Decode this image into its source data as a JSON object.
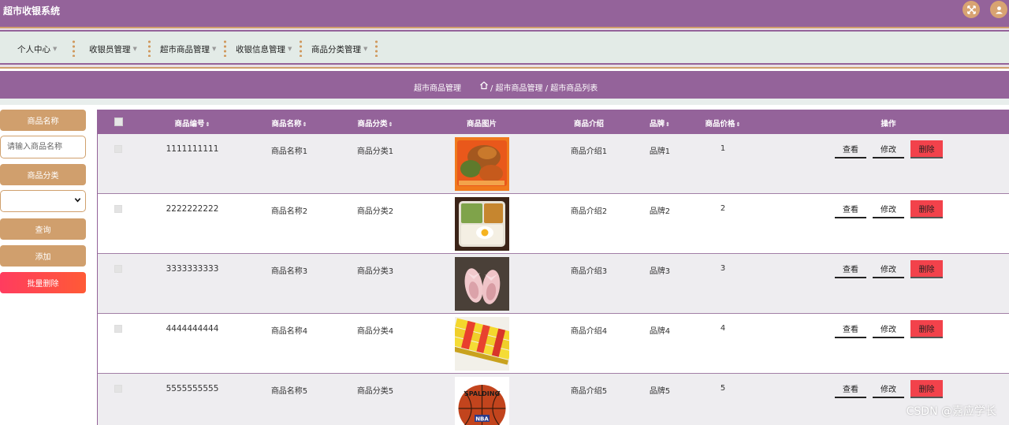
{
  "app": {
    "title": "超市收银系统"
  },
  "header": {
    "fullscreen_icon": "expand-icon",
    "user_icon": "user-icon"
  },
  "nav": {
    "items": [
      {
        "label": "个人中心"
      },
      {
        "label": "收银员管理"
      },
      {
        "label": "超市商品管理"
      },
      {
        "label": "收银信息管理"
      },
      {
        "label": "商品分类管理"
      }
    ]
  },
  "breadcrumb": {
    "title": "超市商品管理",
    "path": "/ 超市商品管理 / 超市商品列表"
  },
  "sidebar": {
    "name_label": "商品名称",
    "name_placeholder": "请输入商品名称",
    "category_label": "商品分类",
    "category_value": "",
    "query_button": "查询",
    "add_button": "添加",
    "batch_delete_button": "批量删除"
  },
  "table": {
    "headers": {
      "code": "商品编号",
      "name": "商品名称",
      "category": "商品分类",
      "image": "商品图片",
      "intro": "商品介绍",
      "brand": "品牌",
      "price": "商品价格",
      "actions": "操作"
    },
    "sort_icon": "⇕",
    "rows": [
      {
        "code": "1111111111",
        "name": "商品名称1",
        "category": "商品分类1",
        "image": "food-plate-image",
        "intro": "商品介绍1",
        "brand": "品牌1",
        "price": "1"
      },
      {
        "code": "2222222222",
        "name": "商品名称2",
        "category": "商品分类2",
        "image": "bento-box-image",
        "intro": "商品介绍2",
        "brand": "品牌2",
        "price": "2"
      },
      {
        "code": "3333333333",
        "name": "商品名称3",
        "category": "商品分类3",
        "image": "pink-shoes-image",
        "intro": "商品介绍3",
        "brand": "品牌3",
        "price": "3"
      },
      {
        "code": "4444444444",
        "name": "商品名称4",
        "category": "商品分类4",
        "image": "snack-rolls-image",
        "intro": "商品介绍4",
        "brand": "品牌4",
        "price": "4"
      },
      {
        "code": "5555555555",
        "name": "商品名称5",
        "category": "商品分类5",
        "image": "basketball-image",
        "intro": "商品介绍5",
        "brand": "品牌5",
        "price": "5"
      }
    ],
    "row_actions": {
      "view": "查看",
      "edit": "修改",
      "delete": "删除"
    },
    "image_texts": {
      "basketball_brand": "SPALDING",
      "basketball_logo": "NBA"
    }
  },
  "watermark": "CSDN @嘉应学长",
  "colors": {
    "primary": "#94639a",
    "accent": "#d09f6d",
    "danger": "#f2424b",
    "nav_bg": "#e3ebe7"
  }
}
